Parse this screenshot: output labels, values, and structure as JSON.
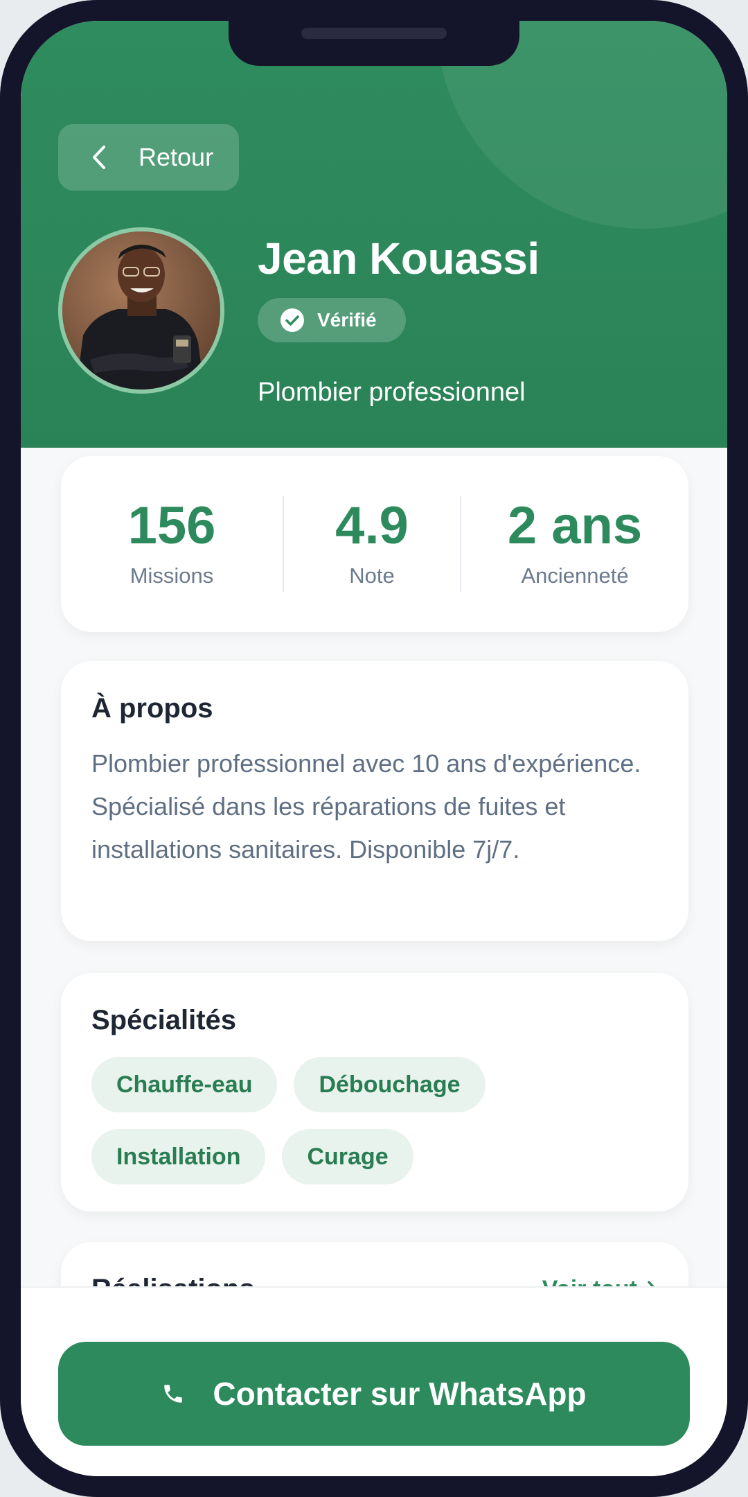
{
  "header": {
    "back_label": "Retour",
    "name": "Jean Kouassi",
    "verified_label": "Vérifié",
    "profession": "Plombier professionnel"
  },
  "stats": [
    {
      "value": "156",
      "label": "Missions"
    },
    {
      "value": "4.9",
      "label": "Note"
    },
    {
      "value": "2 ans",
      "label": "Ancienneté"
    }
  ],
  "about": {
    "title": "À propos",
    "text": "Plombier professionnel avec 10 ans d'expérience. Spécialisé dans les réparations de fuites et installations sanitaires. Disponible 7j/7."
  },
  "specialties": {
    "title": "Spécialités",
    "items": [
      "Chauffe-eau",
      "Débouchage",
      "Installation",
      "Curage"
    ]
  },
  "realisations": {
    "title": "Réalisations",
    "see_all": "Voir tout"
  },
  "cta": {
    "label": "Contacter sur WhatsApp"
  },
  "colors": {
    "primary": "#2d8a5c",
    "chip_bg": "#e7f3ec",
    "muted_text": "#6b7a8d"
  },
  "icons": [
    "chevron-left-icon",
    "check-circle-icon",
    "chevron-right-icon",
    "phone-icon"
  ]
}
